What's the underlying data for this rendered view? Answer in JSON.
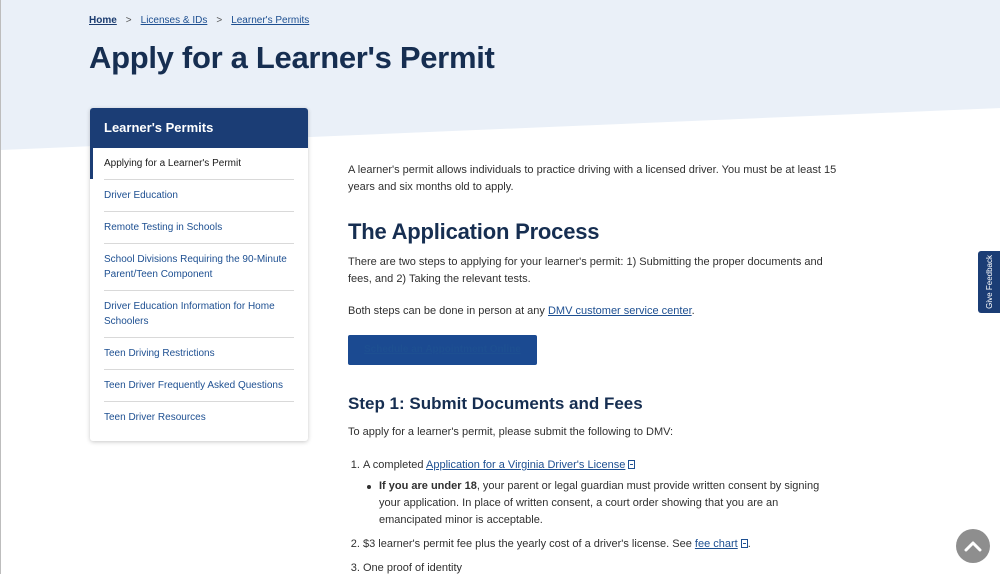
{
  "breadcrumb": {
    "home": "Home",
    "separator": ">",
    "licenses": "Licenses & IDs",
    "current": "Learner's Permits"
  },
  "page_title": "Apply for a Learner's Permit",
  "sidenav": {
    "header": "Learner's Permits",
    "items": [
      "Applying for a Learner's Permit",
      "Driver Education",
      "Remote Testing in Schools",
      "School Divisions Requiring the 90-Minute Parent/Teen Component",
      "Driver Education Information for Home Schoolers",
      "Teen Driving Restrictions",
      "Teen Driver Frequently Asked Questions",
      "Teen Driver Resources"
    ]
  },
  "main": {
    "intro": "A learner's permit allows individuals to practice driving with a licensed driver. You must be at least 15 years and six months old to apply.",
    "h2": "The Application Process",
    "steps_text": "There are two steps to applying for your learner's permit: 1) Submitting the proper documents and fees, and 2) Taking the relevant tests.",
    "both_text": "Both steps can be done in person at any ",
    "both_link": "DMV customer service center",
    "both_end": ".",
    "button": "Schedule an Appointment Online",
    "h3": "Step 1: Submit Documents and Fees",
    "apply_text": "To apply for a learner's permit, please submit the following to DMV:",
    "list": {
      "item1_prefix": "A completed ",
      "item1_link": "Application for a Virginia Driver's License",
      "item1_sub_bold": "If you are under 18",
      "item1_sub_text": ", your parent or legal guardian must provide written consent by signing your application. In place of written consent, a court order showing that you are an emancipated minor is acceptable.",
      "item2_prefix": "$3 learner's permit fee plus the yearly cost of a driver's license. See ",
      "item2_link": "fee chart",
      "item2_end": ".",
      "item3": "One proof of identity"
    }
  },
  "feedback_tab": "Give Feedback",
  "icons": {
    "pdf": "pdf-file-icon",
    "scroll_top": "chevron-up-icon"
  }
}
